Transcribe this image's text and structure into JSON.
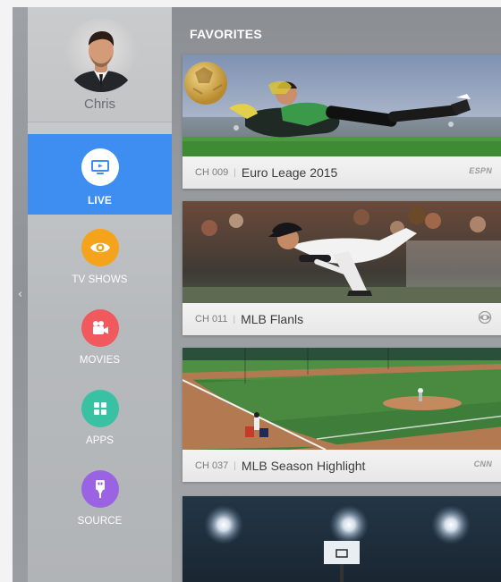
{
  "profile": {
    "name": "Chris"
  },
  "nav": [
    {
      "label": "LIVE",
      "icon": "tv-icon",
      "color": "#ffffff",
      "active": true
    },
    {
      "label": "TV SHOWS",
      "icon": "eye-icon",
      "color": "#f4a31a",
      "active": false
    },
    {
      "label": "MOVIES",
      "icon": "movie-camera-icon",
      "color": "#f0595d",
      "active": false
    },
    {
      "label": "APPS",
      "icon": "apps-grid-icon",
      "color": "#38c1a2",
      "active": false
    },
    {
      "label": "SOURCE",
      "icon": "source-plug-icon",
      "color": "#9a63e3",
      "active": false
    }
  ],
  "section": {
    "title": "FAVORITES"
  },
  "cards": [
    {
      "channel": "CH 009",
      "title": "Euro Leage 2015",
      "network": "ESPN",
      "thumb": "soccer-goalkeeper"
    },
    {
      "channel": "CH 011",
      "title": "MLB Flanls",
      "network": "cbs-eye-icon",
      "thumb": "baseball-pitcher"
    },
    {
      "channel": "CH 037",
      "title": "MLB Season Highlight",
      "network": "CNN",
      "thumb": "baseball-field"
    },
    {
      "thumb": "basketball-arena"
    }
  ],
  "colors": {
    "accent": "#3d8ef0"
  }
}
